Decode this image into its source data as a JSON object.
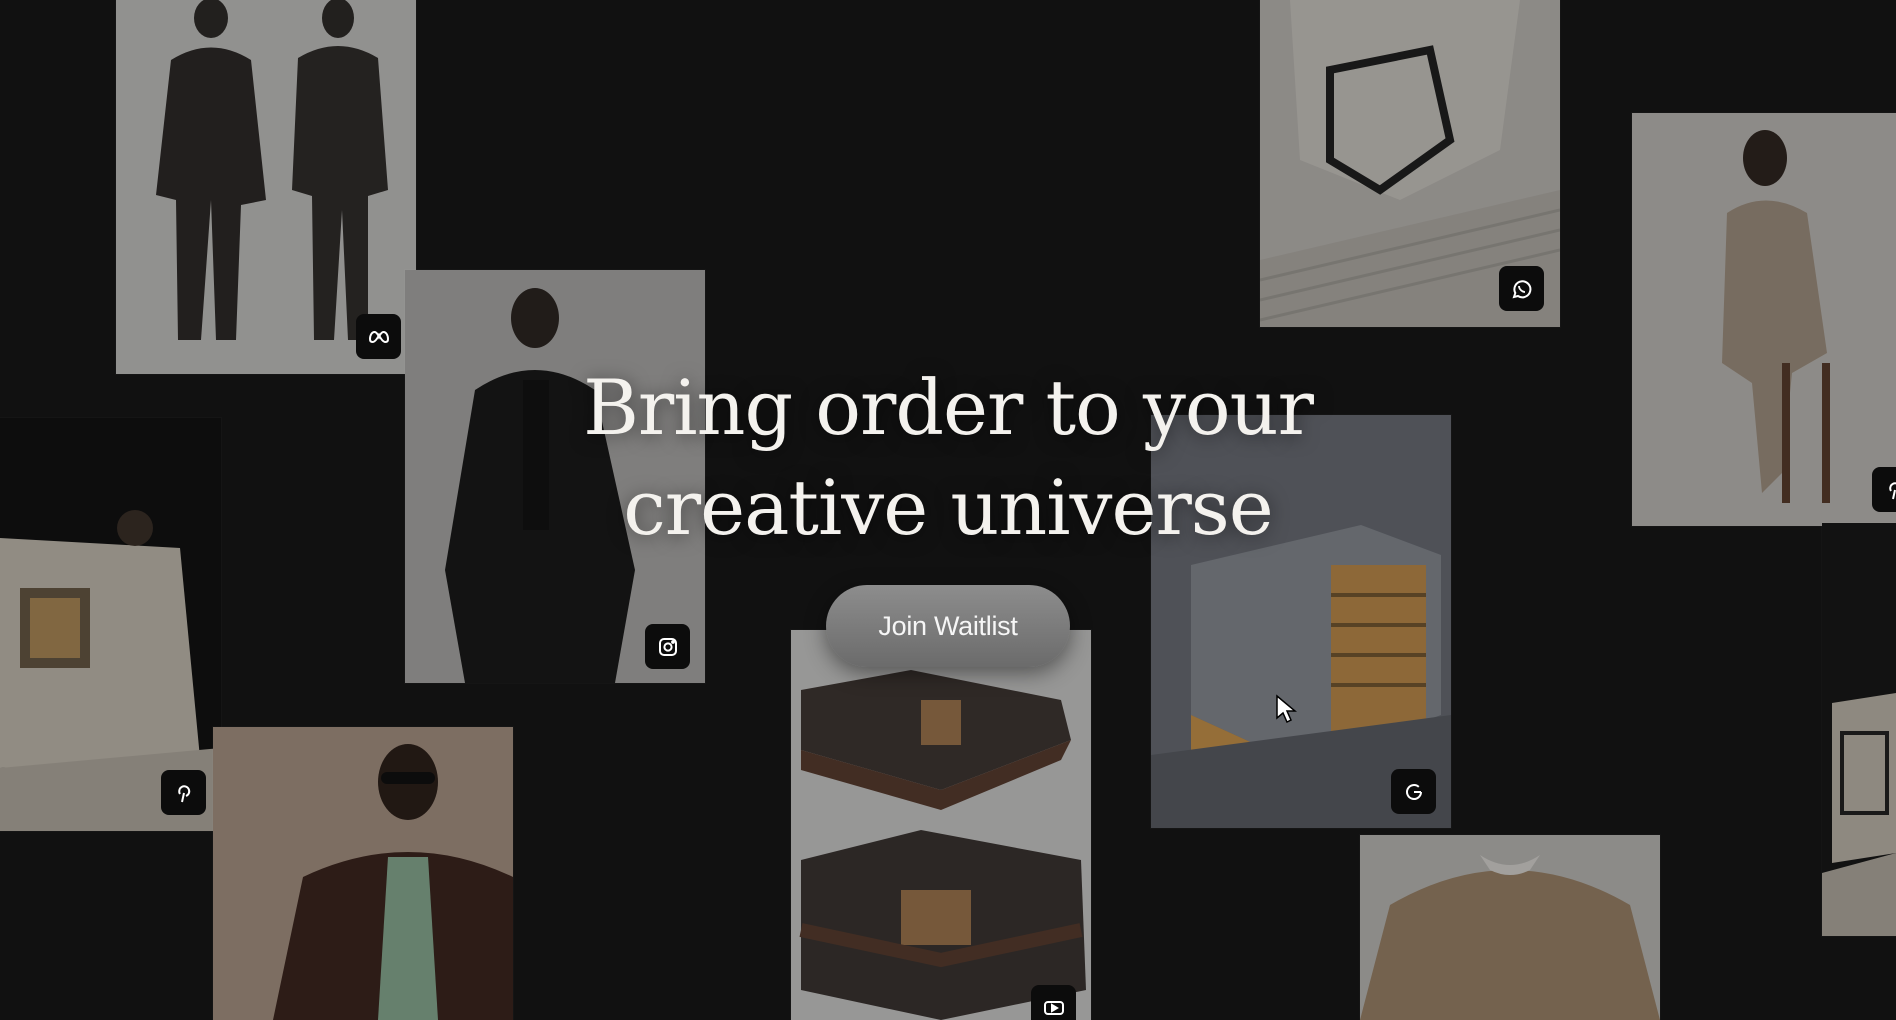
{
  "hero": {
    "title_line1": "Bring order to your",
    "title_line2": "creative universe"
  },
  "cta": {
    "label": "Join Waitlist"
  },
  "cards": [
    {
      "name": "fashion-duo-card",
      "source_icon": "meta-icon"
    },
    {
      "name": "black-suit-card",
      "source_icon": "instagram-icon"
    },
    {
      "name": "architecture-model-card",
      "source_icon": "whatsapp-icon"
    },
    {
      "name": "beige-suit-card",
      "source_icon": "pinterest-icon"
    },
    {
      "name": "pavilion-model-card",
      "source_icon": "pinterest-icon"
    },
    {
      "name": "building-render-card",
      "source_icon": "google-icon"
    },
    {
      "name": "container-house-card",
      "source_icon": "youtube-icon"
    },
    {
      "name": "sunglasses-portrait-card",
      "source_icon": "none"
    },
    {
      "name": "sweater-card",
      "source_icon": "none"
    },
    {
      "name": "edge-architecture-card",
      "source_icon": "none"
    }
  ],
  "colors": {
    "background": "#111111",
    "hero_text": "#f4f2ee",
    "button_bg": "#7c7c7c",
    "badge_bg": "#0c0c0c"
  }
}
